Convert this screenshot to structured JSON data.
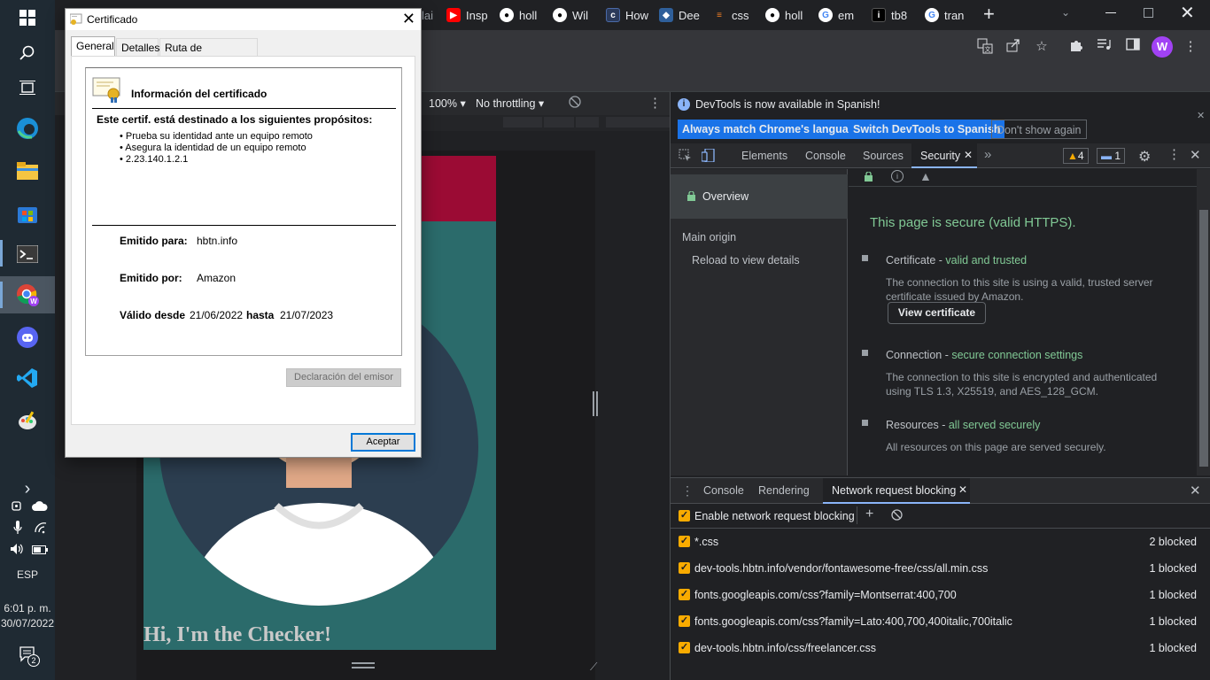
{
  "taskbar": {
    "language": "ESP",
    "time": "6:01 p. m.",
    "date": "30/07/2022",
    "notification_count": "2",
    "chevron": "›"
  },
  "browser": {
    "tabs": [
      {
        "icon": "youtube-icon",
        "label": "Insp",
        "color": "#ff0000"
      },
      {
        "icon": "github-icon",
        "label": "holl",
        "color": "#ffffff"
      },
      {
        "icon": "github-icon",
        "label": "Wil",
        "color": "#ffffff"
      },
      {
        "icon": "page-icon",
        "label": "How",
        "color": "#4a6aa8"
      },
      {
        "icon": "devtools-icon",
        "label": "Dee",
        "color": "#2f5f9a"
      },
      {
        "icon": "stackoverflow-icon",
        "label": "css",
        "color": "#f48024"
      },
      {
        "icon": "github-icon",
        "label": "holl",
        "color": "#ffffff"
      },
      {
        "icon": "google-icon",
        "label": "em",
        "color": "#4285f4"
      },
      {
        "icon": "info-icon",
        "label": "tb8",
        "color": "#000000"
      },
      {
        "icon": "google-icon",
        "label": "tran",
        "color": "#4285f4"
      }
    ],
    "new_tab": "+",
    "profile_initial": "W",
    "partial_tab_label": "lai"
  },
  "device_toolbar": {
    "zoom": "100%",
    "throttling": "No throttling"
  },
  "page": {
    "heading": "Hi, I'm the Checker!"
  },
  "dialog": {
    "title": "Certificado",
    "tabs": [
      "General",
      "Detalles",
      "Ruta de certificación"
    ],
    "cert_heading": "Información del certificado",
    "purpose_title": "Este certif. está destinado a los siguientes propósitos:",
    "purposes": [
      "• Prueba su identidad ante un equipo remoto",
      "• Asegura la identidad de un equipo remoto",
      "• 2.23.140.1.2.1"
    ],
    "issued_to_label": "Emitido para:",
    "issued_to": "hbtn.info",
    "issued_by_label": "Emitido por:",
    "issued_by": "Amazon",
    "valid_from_label": "Válido desde",
    "valid_from": "21/06/2022",
    "valid_to_label": "hasta",
    "valid_to": "21/07/2023",
    "issuer_statement_button": "Declaración del emisor",
    "ok_button": "Aceptar"
  },
  "devtools": {
    "info_message": "DevTools is now available in Spanish!",
    "info_buttons": [
      "Always match Chrome's language",
      "Switch DevTools to Spanish",
      "Don't show again"
    ],
    "tabs": [
      "Elements",
      "Console",
      "Sources",
      "Security"
    ],
    "warnings_count": "4",
    "messages_count": "1",
    "security": {
      "sidebar_overview": "Overview",
      "sidebar_main_origin": "Main origin",
      "sidebar_reload": "Reload to view details",
      "summary": "This page is secure (valid HTTPS).",
      "certificate_title": "Certificate - ",
      "certificate_status": "valid and trusted",
      "certificate_desc_1": "The connection to this site is using a valid, trusted server",
      "certificate_desc_2": "certificate issued by Amazon.",
      "view_certificate": "View certificate",
      "connection_title": "Connection - ",
      "connection_status": "secure connection settings",
      "connection_desc_1": "The connection to this site is encrypted and authenticated",
      "connection_desc_2": "using TLS 1.3, X25519, and AES_128_GCM.",
      "resources_title": "Resources - ",
      "resources_status": "all served securely",
      "resources_desc": "All resources on this page are served securely."
    },
    "drawer": {
      "tabs": [
        "Console",
        "Rendering",
        "Network request blocking"
      ],
      "enable_label": "Enable network request blocking",
      "rows": [
        {
          "pattern": "*.css",
          "count": "2 blocked"
        },
        {
          "pattern": "dev-tools.hbtn.info/vendor/fontawesome-free/css/all.min.css",
          "count": "1 blocked"
        },
        {
          "pattern": "fonts.googleapis.com/css?family=Montserrat:400,700",
          "count": "1 blocked"
        },
        {
          "pattern": "fonts.googleapis.com/css?family=Lato:400,700,400italic,700italic",
          "count": "1 blocked"
        },
        {
          "pattern": "dev-tools.hbtn.info/css/freelancer.css",
          "count": "1 blocked"
        }
      ]
    }
  },
  "colors": {
    "accent": "#8ab4f8",
    "secure_green": "#81c995",
    "checkbox": "#f9ab00",
    "ok_border": "#0078d7",
    "page_teal": "#2b6b6b",
    "page_red": "#9b0b34"
  }
}
